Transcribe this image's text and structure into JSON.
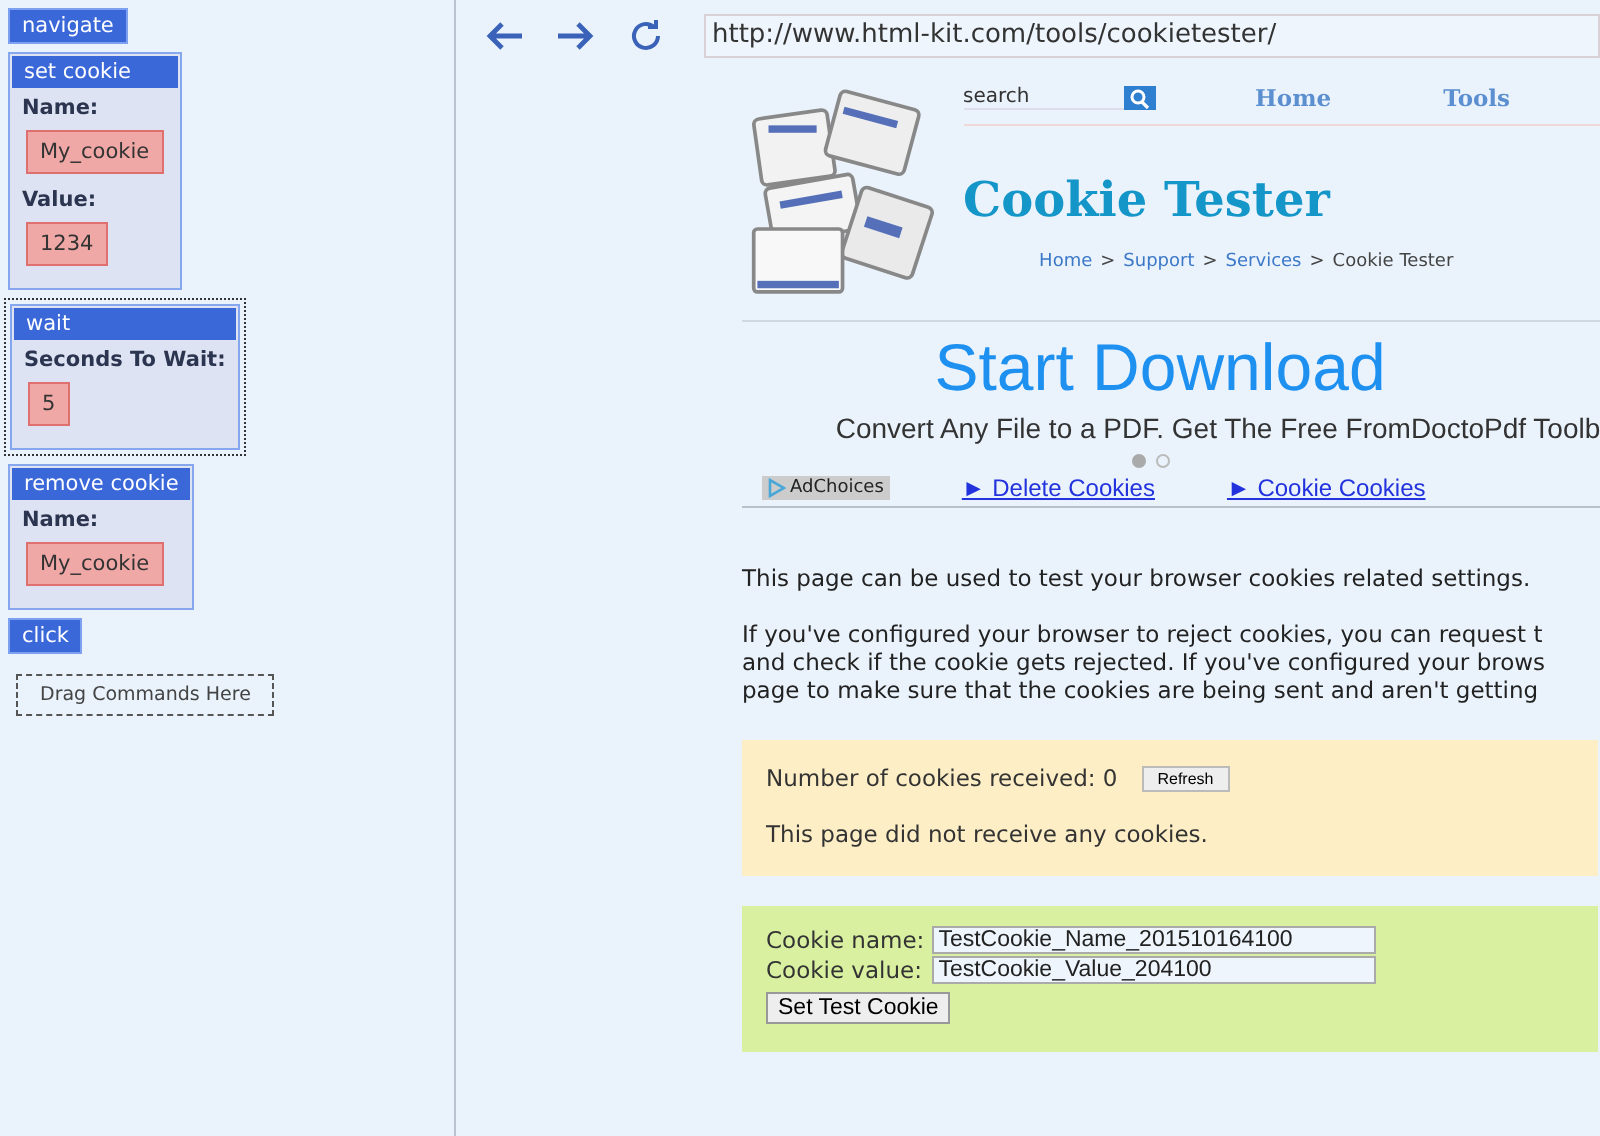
{
  "commands": [
    {
      "kind": "simple",
      "title": "navigate",
      "selected": false
    },
    {
      "kind": "block",
      "title": "set cookie",
      "selected": false,
      "fields": [
        {
          "label": "Name:",
          "value": "My_cookie"
        },
        {
          "label": "Value:",
          "value": "1234"
        }
      ]
    },
    {
      "kind": "block",
      "title": "wait",
      "selected": true,
      "fields": [
        {
          "label": "Seconds To Wait:",
          "value": "5"
        }
      ]
    },
    {
      "kind": "block",
      "title": "remove cookie",
      "selected": false,
      "fields": [
        {
          "label": "Name:",
          "value": "My_cookie"
        }
      ]
    },
    {
      "kind": "simple",
      "title": "click",
      "selected": false
    }
  ],
  "drop_zone": "Drag Commands Here",
  "browser": {
    "url": "http://www.html-kit.com/tools/cookietester/"
  },
  "site": {
    "search_placeholder": "search",
    "nav": [
      "Home",
      "Tools"
    ],
    "title": "Cookie Tester",
    "breadcrumb": [
      {
        "label": "Home",
        "link": true
      },
      {
        "label": "Support",
        "link": true
      },
      {
        "label": "Services",
        "link": true
      },
      {
        "label": "Cookie Tester",
        "link": false
      }
    ],
    "separator": ">",
    "ad": {
      "headline": "Start Download",
      "text": "Convert Any File to a PDF. Get The Free FromDoctoPdf Toolb",
      "dots": [
        {
          "selected": true
        },
        {
          "selected": false
        }
      ],
      "adchoices": "AdChoices",
      "links": [
        "► Delete Cookies",
        "► Cookie Cookies"
      ]
    },
    "intro": "This page can be used to test your browser cookies related settings.",
    "para": [
      "If you've configured your browser to reject cookies, you can request t",
      "and check if the cookie gets rejected. If you've configured your brows",
      "page to make sure that the cookies are being sent and aren't getting"
    ],
    "received": {
      "label": "Number of cookies received: 0",
      "button": "Refresh",
      "message": "This page did not receive any cookies."
    },
    "form": {
      "fields": [
        {
          "label": "Cookie name:",
          "value": "TestCookie_Name_201510164100"
        },
        {
          "label": "Cookie value:",
          "value": "TestCookie_Value_204100"
        }
      ],
      "button": "Set Test Cookie"
    }
  }
}
